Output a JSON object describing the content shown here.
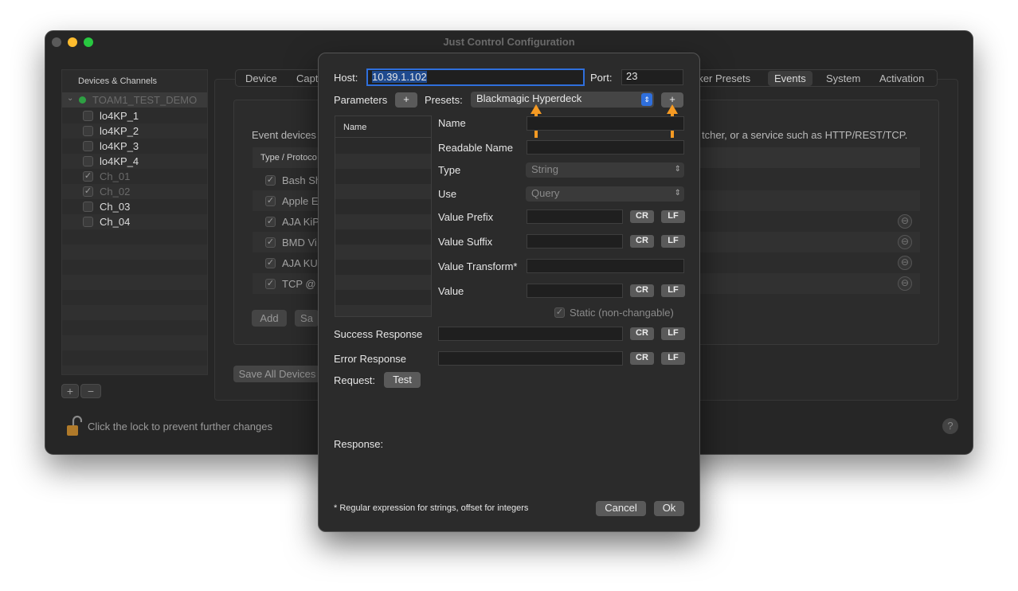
{
  "window": {
    "title": "Just Control Configuration",
    "traffic_colors": [
      "#ff5f57",
      "#febc2e",
      "#28c840"
    ]
  },
  "sidebar": {
    "header": "Devices & Channels",
    "device": "TOAM1_TEST_DEMO",
    "items": [
      {
        "label": "lo4KP_1",
        "checked": false,
        "dim": false
      },
      {
        "label": "lo4KP_2",
        "checked": false,
        "dim": false
      },
      {
        "label": "lo4KP_3",
        "checked": false,
        "dim": false
      },
      {
        "label": "lo4KP_4",
        "checked": false,
        "dim": false
      },
      {
        "label": "Ch_01",
        "checked": true,
        "dim": true
      },
      {
        "label": "Ch_02",
        "checked": true,
        "dim": true
      },
      {
        "label": "Ch_03",
        "checked": false,
        "dim": false
      },
      {
        "label": "Ch_04",
        "checked": false,
        "dim": false
      }
    ],
    "add_label": "+",
    "remove_label": "−"
  },
  "tabs": {
    "left": [
      "Device",
      "Capt"
    ],
    "right": [
      "rker Presets",
      "Events",
      "System",
      "Activation"
    ],
    "selected": "Events"
  },
  "events": {
    "description_left": "Event devices",
    "description_right": "tcher, or a service such as HTTP/REST/TCP.",
    "column_header": "Type / Protoco",
    "rows": [
      "Bash Sh",
      "Apple E",
      "AJA KiP",
      "BMD Vi",
      "AJA KU",
      "TCP @"
    ],
    "add_label": "Add",
    "save_partial": "Sa",
    "save_all": "Save All Devices"
  },
  "lock": {
    "text": "Click the lock to prevent further changes"
  },
  "help_label": "?",
  "dialog": {
    "host_label": "Host:",
    "host_value": "10.39.1.102",
    "port_label": "Port:",
    "port_value": "23",
    "parameters_label": "Parameters",
    "plus": "+",
    "presets_label": "Presets:",
    "preset_value": "Blackmagic Hyperdeck",
    "list_header": "Name",
    "fields": {
      "name": "Name",
      "readable_name": "Readable Name",
      "type": "Type",
      "type_value": "String",
      "use": "Use",
      "use_value": "Query",
      "value_prefix": "Value Prefix",
      "value_suffix": "Value Suffix",
      "value_transform": "Value Transform*",
      "value": "Value",
      "static": "Static (non-changable)"
    },
    "cr": "CR",
    "lf": "LF",
    "success_label": "Success Response",
    "error_label": "Error Response",
    "request_label": "Request:",
    "test_label": "Test",
    "response_label": "Response:",
    "footnote": "* Regular expression for strings, offset for integers",
    "cancel_label": "Cancel",
    "ok_label": "Ok"
  },
  "colors": {
    "accent_blue": "#2f6fdc",
    "arrow_orange": "#f59a23"
  }
}
